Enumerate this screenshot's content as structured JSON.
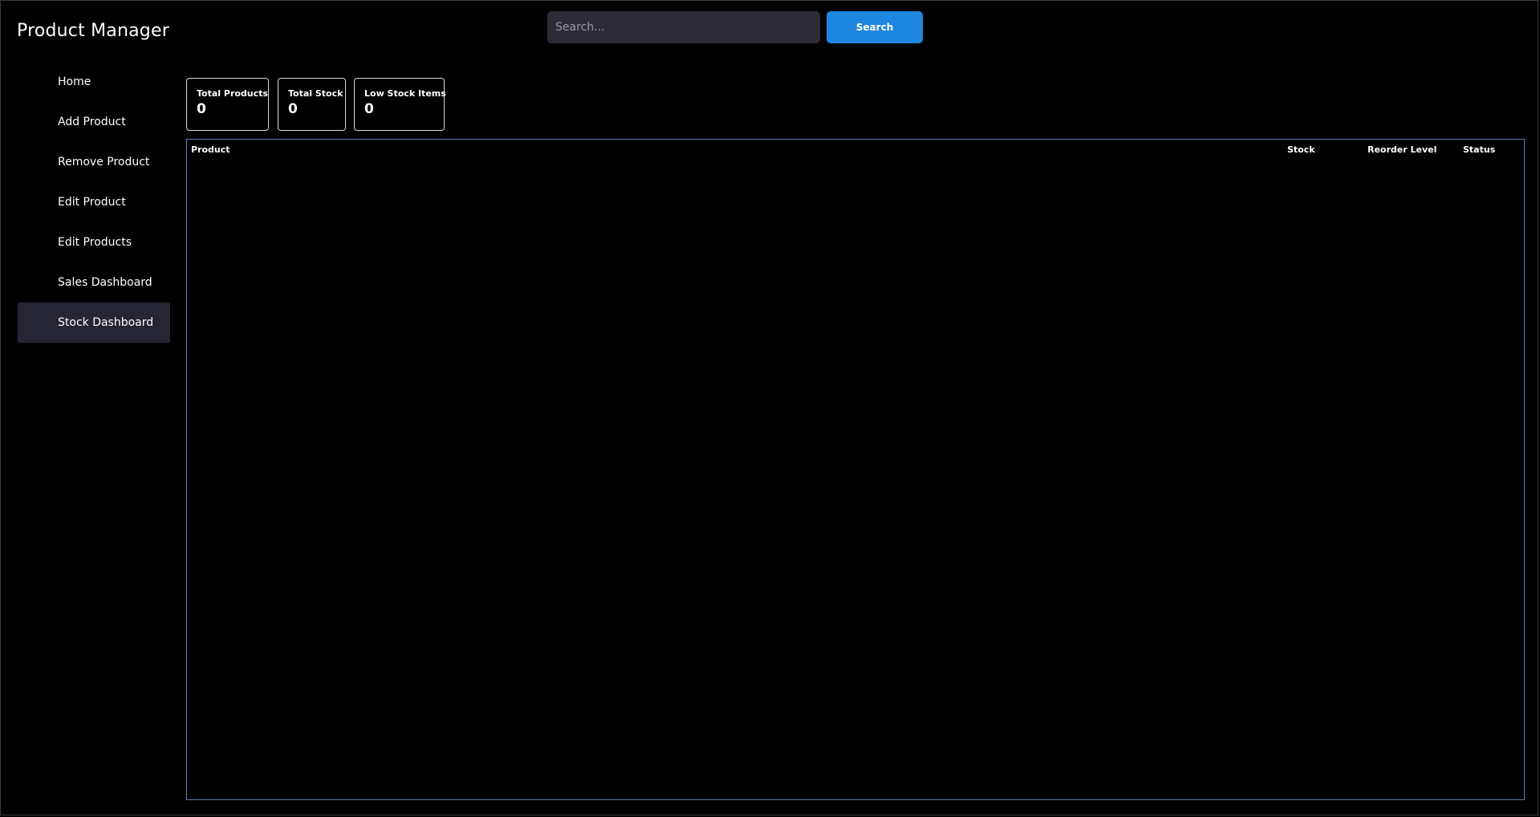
{
  "app": {
    "title": "Product Manager"
  },
  "search": {
    "placeholder": "Search...",
    "value": "",
    "button_label": "Search"
  },
  "sidebar": {
    "items": [
      {
        "label": "Home",
        "active": false
      },
      {
        "label": "Add Product",
        "active": false
      },
      {
        "label": "Remove Product",
        "active": false
      },
      {
        "label": "Edit Product",
        "active": false
      },
      {
        "label": "Edit Products",
        "active": false
      },
      {
        "label": "Sales Dashboard",
        "active": false
      },
      {
        "label": "Stock Dashboard",
        "active": true
      }
    ]
  },
  "stats": [
    {
      "label": "Total Products",
      "value": "0"
    },
    {
      "label": "Total Stock",
      "value": "0"
    },
    {
      "label": "Low Stock Items",
      "value": "0"
    }
  ],
  "table": {
    "columns": [
      "Product",
      "Stock",
      "Reorder Level",
      "Status"
    ],
    "rows": []
  },
  "colors": {
    "background": "#000000",
    "accent": "#1f86e0",
    "input_bg": "#2c2b36",
    "active_item_bg": "#262533",
    "table_border": "#5a7fb0"
  }
}
